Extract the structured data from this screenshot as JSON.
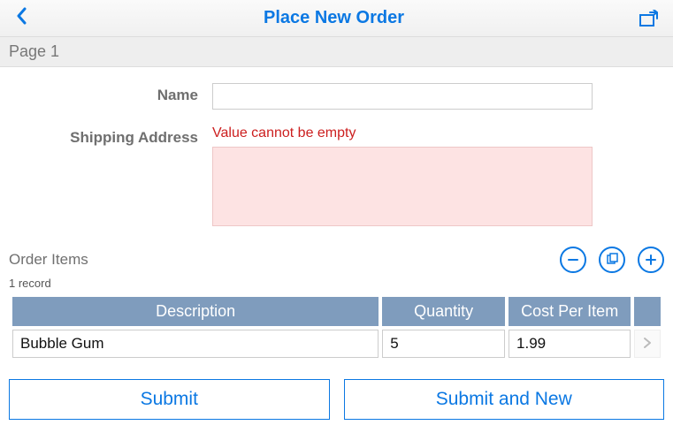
{
  "header": {
    "title": "Place New Order"
  },
  "page_label": "Page 1",
  "form": {
    "name_label": "Name",
    "name_value": "",
    "addr_label": "Shipping Address",
    "addr_error": "Value cannot be empty",
    "addr_value": ""
  },
  "items_section": {
    "label": "Order Items",
    "record_count": "1 record"
  },
  "table": {
    "columns": {
      "desc": "Description",
      "qty": "Quantity",
      "cost": "Cost Per Item"
    },
    "rows": [
      {
        "desc": "Bubble Gum",
        "qty": "5",
        "cost": "1.99"
      }
    ]
  },
  "buttons": {
    "submit": "Submit",
    "submit_new": "Submit and New"
  }
}
